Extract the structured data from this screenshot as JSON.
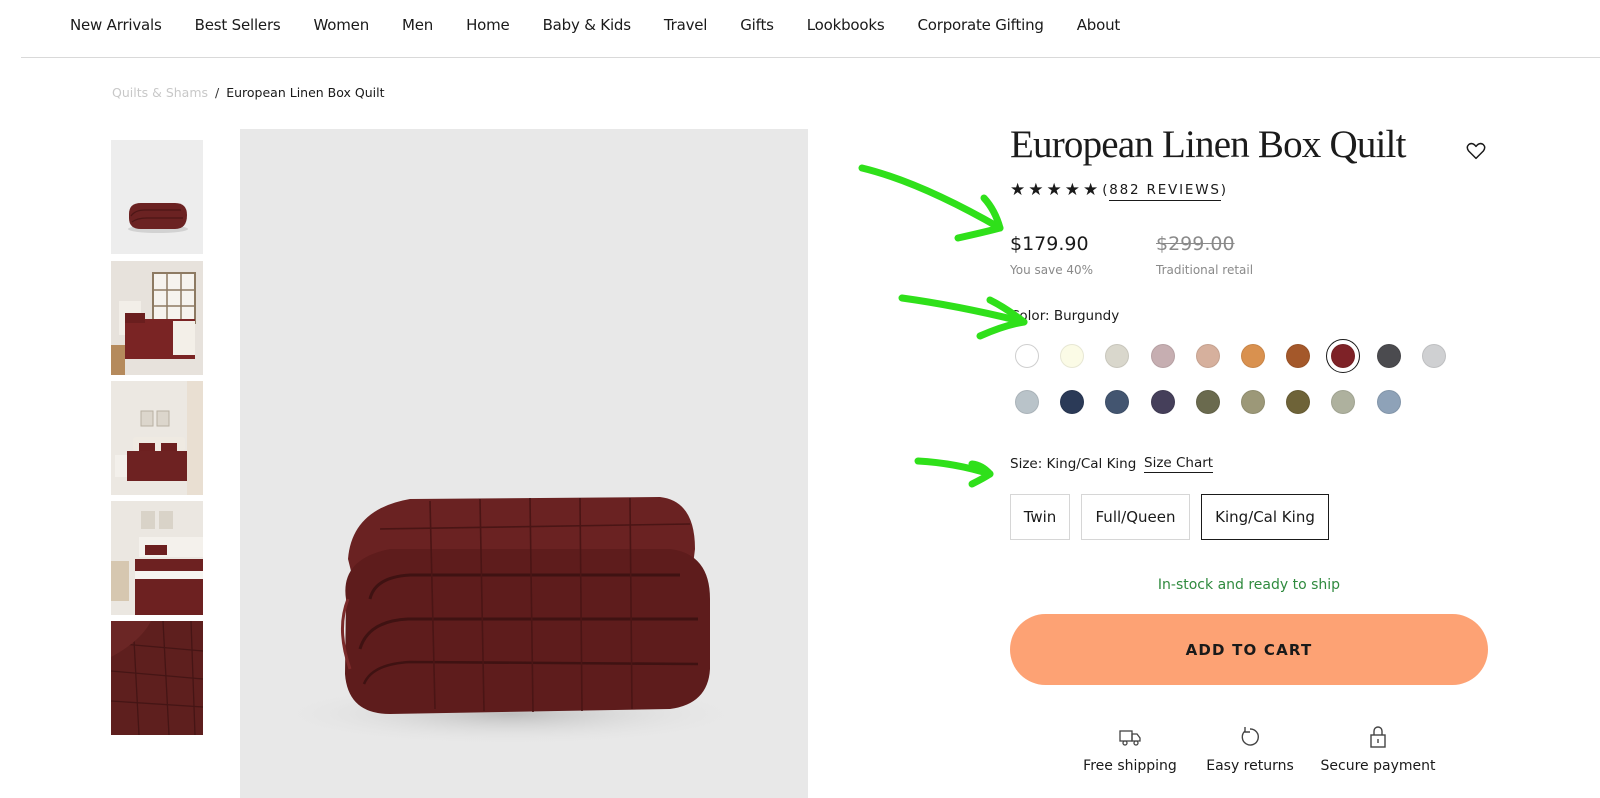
{
  "nav": {
    "items": [
      "New Arrivals",
      "Best Sellers",
      "Women",
      "Men",
      "Home",
      "Baby & Kids",
      "Travel",
      "Gifts",
      "Lookbooks",
      "Corporate Gifting",
      "About"
    ]
  },
  "breadcrumb": {
    "parent": "Quilts & Shams",
    "separator": "/",
    "current": "European Linen Box Quilt"
  },
  "product": {
    "title": "European Linen Box Quilt",
    "stars": "★★★★★",
    "reviews_open": "(",
    "reviews_text": "882 REVIEWS",
    "reviews_close": ")",
    "price": "$179.90",
    "savings": "You save 40%",
    "original_price": "$299.00",
    "original_label": "Traditional retail",
    "color_label": "Color: Burgundy",
    "selected_color": "Burgundy",
    "swatches": [
      "#ffffff",
      "#fbfbe6",
      "#d9d7cc",
      "#c6aeb1",
      "#d6b09d",
      "#d9914f",
      "#a4582a",
      "#7e2227",
      "#4b4b4f",
      "#cfd0d2",
      "#b9c3c9",
      "#2b3a57",
      "#435570",
      "#453f5a",
      "#6a6a4e",
      "#9c9878",
      "#6e6338",
      "#aeb19e",
      "#8ea2b8"
    ],
    "size_label": "Size: King/Cal King",
    "size_chart": "Size Chart",
    "sizes": [
      "Twin",
      "Full/Queen",
      "King/Cal King"
    ],
    "selected_size": "King/Cal King",
    "stock": "In-stock and ready to ship",
    "add_to_cart": "ADD TO CART",
    "perks": [
      "Free shipping",
      "Easy returns",
      "Secure payment"
    ]
  },
  "colors": {
    "accent_button": "#fda274",
    "stock_green": "#2f8a3e",
    "annotation_arrow": "#2fe01a"
  }
}
